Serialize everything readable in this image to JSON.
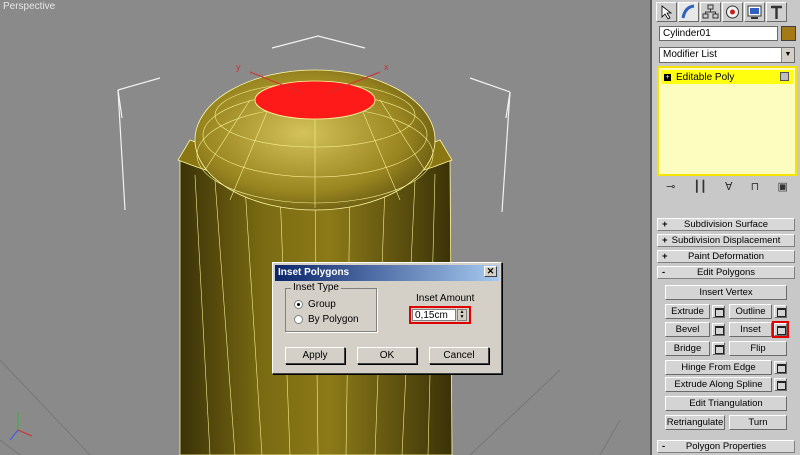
{
  "viewport": {
    "label": "Perspective"
  },
  "dialog": {
    "title": "Inset Polygons",
    "close": "✕",
    "group_label": "Inset Type",
    "options": [
      "Group",
      "By Polygon"
    ],
    "selected_option": "Group",
    "amount_label": "Inset Amount",
    "amount_value": "0,15cm",
    "buttons": {
      "apply": "Apply",
      "ok": "OK",
      "cancel": "Cancel"
    }
  },
  "panel": {
    "tabs": [
      "create-icon",
      "modify-icon",
      "hierarchy-icon",
      "motion-icon",
      "display-icon",
      "utilities-icon"
    ],
    "active_tab": "modify-icon",
    "object_name": "Cylinder01",
    "object_color": "#a37a15",
    "modifier_list": "Modifier List",
    "stack_item": "Editable Poly",
    "stack_tools": [
      "pin-stack-icon",
      "show-end-result-icon",
      "make-unique-icon",
      "remove-modifier-icon",
      "configure-sets-icon"
    ],
    "rollouts": [
      {
        "sign": "+",
        "label": "Subdivision Surface"
      },
      {
        "sign": "+",
        "label": "Subdivision Displacement"
      },
      {
        "sign": "+",
        "label": "Paint Deformation"
      },
      {
        "sign": "-",
        "label": "Edit Polygons"
      }
    ],
    "edit_buttons": {
      "insert_vertex": "Insert Vertex",
      "extrude": "Extrude",
      "outline": "Outline",
      "bevel": "Bevel",
      "inset": "Inset",
      "bridge": "Bridge",
      "flip": "Flip",
      "hinge": "Hinge From Edge",
      "extrude_spline": "Extrude Along Spline",
      "edit_tri": "Edit Triangulation",
      "retriangulate": "Retriangulate",
      "turn": "Turn"
    },
    "bottom_rollout": {
      "sign": "-",
      "label": "Polygon Properties"
    }
  },
  "colors": {
    "model": "#8c7a12",
    "selection": "#ff1a1a",
    "highlight": "#e00000",
    "stack_yellow": "#ffff10"
  }
}
